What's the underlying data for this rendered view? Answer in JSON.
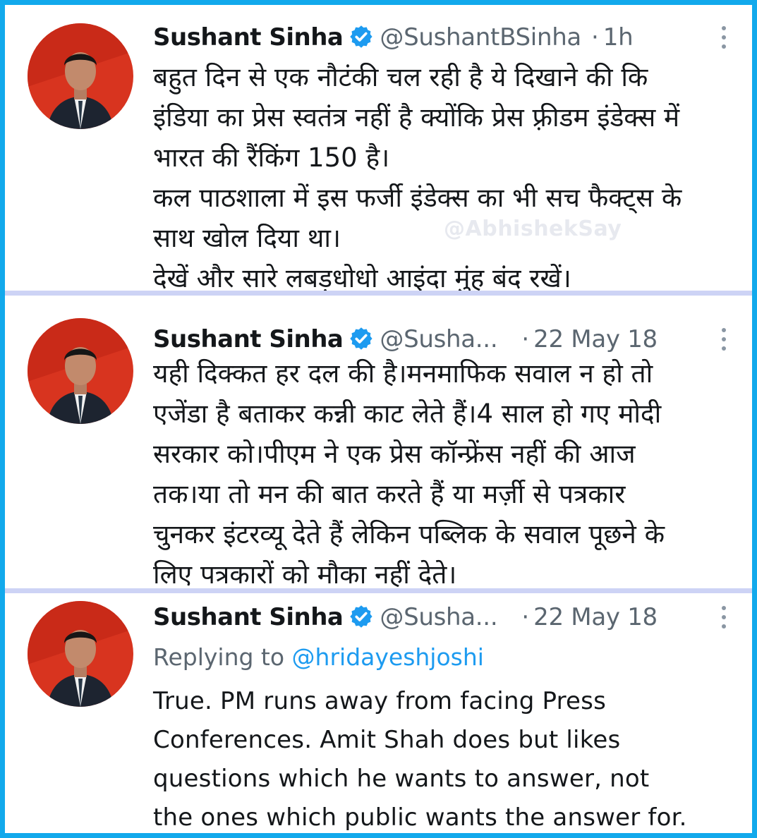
{
  "colors": {
    "frame_border": "#12a9ec",
    "separator": "#cdd3f5",
    "verified_badge": "#1d9bf0",
    "mention": "#1d9bf0",
    "avatar_background": "#d8341f"
  },
  "watermark": "@AbhishekSay",
  "tweets": [
    {
      "author_name": "Sushant Sinha",
      "handle": "@SushantBSinha",
      "separator": "·",
      "timestamp": "1h",
      "icons": [
        "avatar",
        "verified-badge-icon",
        "more-options-icon"
      ],
      "lines": [
        "बहुत दिन से एक नौटंकी चल रही है ये दिखाने की कि",
        "इंडिया का प्रेस स्वतंत्र नहीं है क्योंकि प्रेस फ़्रीडम इंडेक्स में",
        "भारत की रैंकिंग 150 है।",
        "कल पाठशाला में इस फर्जी इंडेक्स का भी सच फैक्ट्स के",
        "साथ खोल दिया था।",
        "देखें और सारे लबड़धोधो आइंदा मुंह बंद रखें।"
      ]
    },
    {
      "author_name": "Sushant Sinha",
      "handle": "@Susha...",
      "separator": "·",
      "timestamp": "22 May 18",
      "icons": [
        "avatar",
        "verified-badge-icon",
        "more-options-icon"
      ],
      "lines": [
        "यही दिक्कत हर दल की है।मनमाफिक सवाल न हो तो",
        "एजेंडा है बताकर कन्नी काट लेते हैं।4 साल हो गए मोदी",
        "सरकार को।पीएम ने एक प्रेस कॉन्फ्रेंस नहीं की आज",
        "तक।या तो मन की बात करते हैं या मर्ज़ी से पत्रकार",
        "चुनकर इंटरव्यू देते हैं लेकिन पब्लिक के सवाल पूछने के",
        "लिए पत्रकारों को मौका नहीं देते।"
      ]
    },
    {
      "author_name": "Sushant Sinha",
      "handle": "@Susha...",
      "separator": "·",
      "timestamp": "22 May 18",
      "replying_to_label": "Replying to",
      "replying_to_handle": "@hridayeshjoshi",
      "icons": [
        "avatar",
        "verified-badge-icon",
        "more-options-icon"
      ],
      "lines": [
        "True. PM runs away from facing Press",
        "Conferences. Amit Shah does but likes",
        "questions which he wants to answer, not",
        "the ones which public wants the answer for."
      ]
    }
  ]
}
